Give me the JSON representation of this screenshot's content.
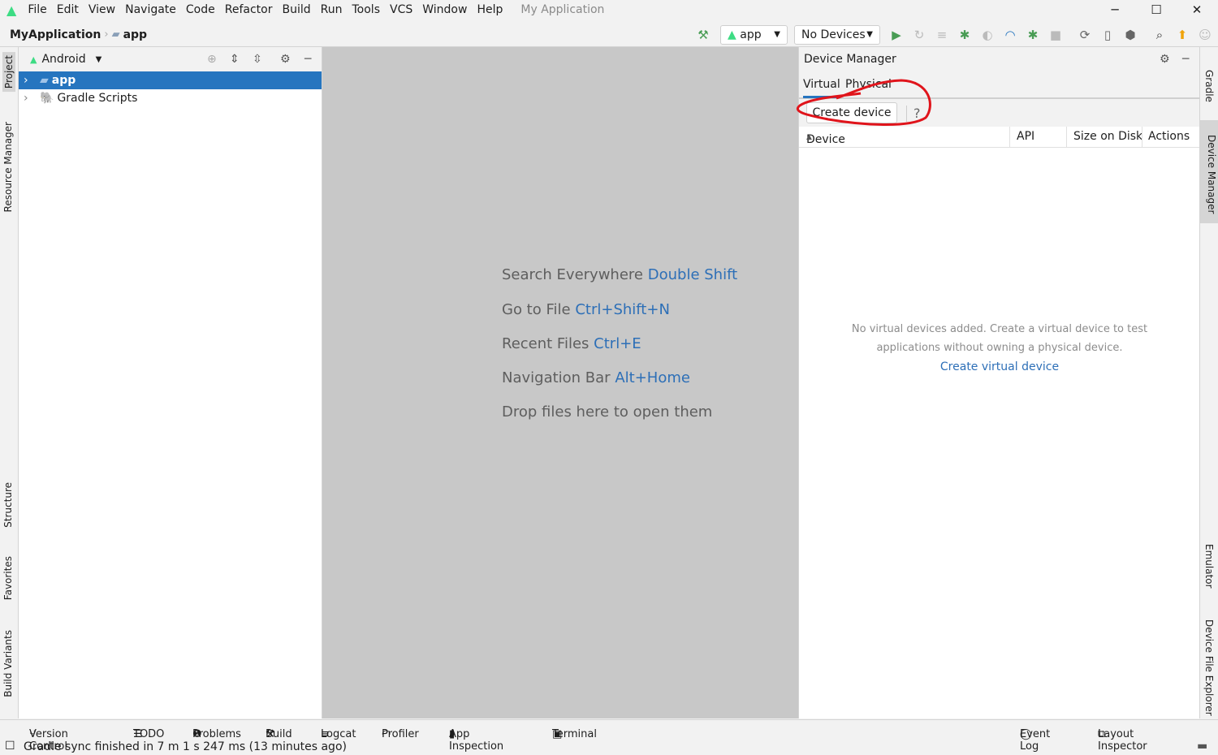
{
  "menu": {
    "items": [
      "File",
      "Edit",
      "View",
      "Navigate",
      "Code",
      "Refactor",
      "Build",
      "Run",
      "Tools",
      "VCS",
      "Window",
      "Help"
    ],
    "title": "My Application"
  },
  "navbar": {
    "project": "MyApplication",
    "module": "app",
    "run_config": "app",
    "device": "No Devices"
  },
  "left_tabs": [
    "Project",
    "Resource Manager",
    "Structure",
    "Favorites",
    "Build Variants"
  ],
  "right_tabs": [
    "Gradle",
    "Device Manager",
    "Emulator",
    "Device File Explorer"
  ],
  "project": {
    "view": "Android",
    "tree": [
      {
        "label": "app",
        "selected": true
      },
      {
        "label": "Gradle Scripts",
        "selected": false
      }
    ]
  },
  "editor": {
    "hints": [
      {
        "text": "Search Everywhere",
        "key": "Double Shift"
      },
      {
        "text": "Go to File",
        "key": "Ctrl+Shift+N"
      },
      {
        "text": "Recent Files",
        "key": "Ctrl+E"
      },
      {
        "text": "Navigation Bar",
        "key": "Alt+Home"
      },
      {
        "text": "Drop files here to open them",
        "key": ""
      }
    ]
  },
  "device_manager": {
    "title": "Device Manager",
    "tabs": [
      "Virtual",
      "Physical"
    ],
    "active_tab": "Virtual",
    "create_button": "Create device",
    "help": "?",
    "columns": [
      "Device",
      "API",
      "Size on Disk",
      "Actions"
    ],
    "empty_line1": "No virtual devices added. Create a virtual device to test",
    "empty_line2": "applications without owning a physical device.",
    "empty_link": "Create virtual device"
  },
  "bottom_tools": [
    "Version Control",
    "TODO",
    "Problems",
    "Build",
    "Logcat",
    "Profiler",
    "App Inspection",
    "Terminal"
  ],
  "bottom_right_tools": [
    "Event Log",
    "Layout Inspector"
  ],
  "status": "Gradle sync finished in 7 m 1 s 247 ms (13 minutes ago)",
  "colors": {
    "accent": "#2675bf",
    "android_green": "#3ddc84",
    "annotation": "#e0141b"
  }
}
